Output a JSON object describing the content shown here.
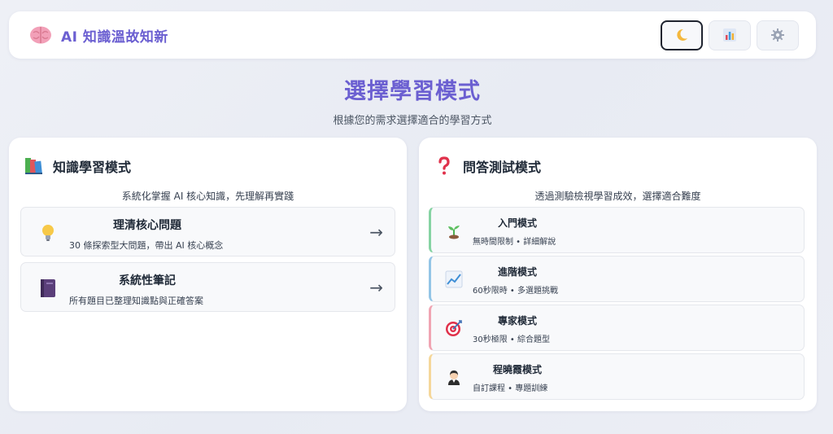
{
  "header": {
    "logo_icon": "brain-icon",
    "title": "AI 知識溫故知新",
    "actions": [
      {
        "name": "theme-toggle-button",
        "icon": "moon-icon",
        "active": true
      },
      {
        "name": "stats-button",
        "icon": "bar-chart-icon",
        "active": false
      },
      {
        "name": "settings-button",
        "icon": "gear-icon",
        "active": false
      }
    ]
  },
  "page": {
    "title": "選擇學習模式",
    "subtitle": "根據您的需求選擇適合的學習方式"
  },
  "learning_panel": {
    "icon": "books-icon",
    "title": "知識學習模式",
    "description": "系統化掌握 AI 核心知識，先理解再實踐",
    "modes": [
      {
        "icon": "lightbulb-icon",
        "title": "理清核心問題",
        "description": "30 條探索型大問題，帶出 AI 核心概念",
        "arrow": "→"
      },
      {
        "icon": "notebook-icon",
        "title": "系統性筆記",
        "description": "所有題目已整理知識點與正確答案",
        "arrow": "→"
      }
    ]
  },
  "quiz_panel": {
    "icon": "question-mark-icon",
    "title": "問答測試模式",
    "description": "透過測驗檢視學習成效，選擇適合難度",
    "modes": [
      {
        "icon": "seedling-icon",
        "title": "入門模式",
        "description": "無時間限制 • 詳細解說",
        "accent": "#86d3a3"
      },
      {
        "icon": "trend-chart-icon",
        "title": "進階模式",
        "description": "60秒限時 • 多選題挑戰",
        "accent": "#93c5e6"
      },
      {
        "icon": "target-icon",
        "title": "專家模式",
        "description": "30秒極限 • 綜合題型",
        "accent": "#f0a5b3"
      },
      {
        "icon": "person-icon",
        "title": "程曉霞模式",
        "description": "自訂課程 • 專題訓練",
        "accent": "#f5d79a"
      }
    ]
  }
}
